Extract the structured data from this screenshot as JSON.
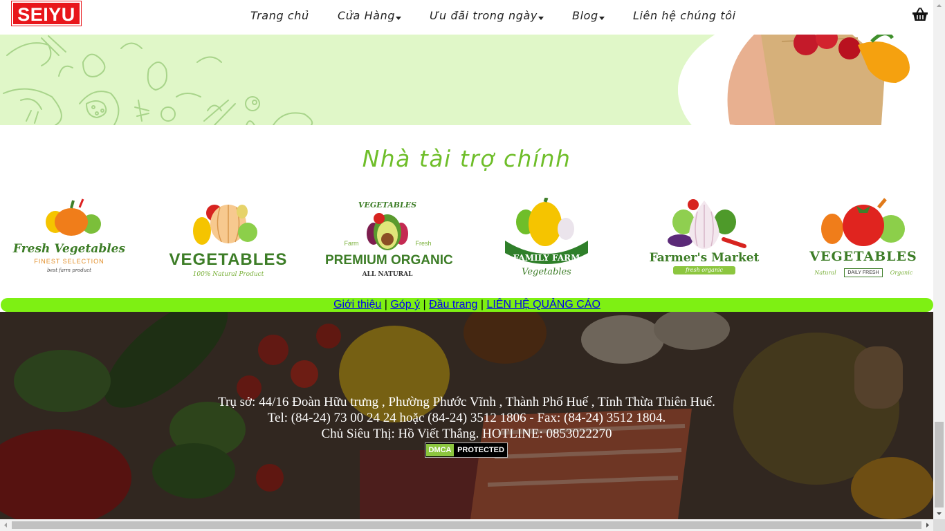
{
  "header": {
    "logo_text": "SEIYU",
    "nav": [
      {
        "label": "Trang chủ",
        "has_dropdown": false
      },
      {
        "label": "Cửa Hàng",
        "has_dropdown": true
      },
      {
        "label": "Ưu đãi trong ngày",
        "has_dropdown": true
      },
      {
        "label": "Blog",
        "has_dropdown": true
      },
      {
        "label": "Liên hệ chúng tôi",
        "has_dropdown": false
      }
    ],
    "cart_icon": "basket-icon"
  },
  "sponsors": {
    "title": "Nhà tài trợ chính",
    "items": [
      {
        "name": "Fresh Vegetables",
        "tagline": "FINEST SELECTION",
        "sub": "best farm product"
      },
      {
        "name": "VEGETABLES",
        "tagline": "100% Natural Product",
        "sub": ""
      },
      {
        "name": "PREMIUM ORGANIC",
        "tagline": "ALL NATURAL",
        "sub": "VEGETABLES",
        "left": "Farm",
        "right": "Fresh"
      },
      {
        "name": "FAMILY FARM",
        "tagline": "Vegetables",
        "sub": ""
      },
      {
        "name": "Farmer's Market",
        "tagline": "fresh organic",
        "sub": ""
      },
      {
        "name": "VEGETABLES",
        "tagline": "DAILY FRESH",
        "left": "Natural",
        "right": "Organic"
      }
    ]
  },
  "footer_links": {
    "items": [
      "Giới thiệu",
      "Góp ý",
      "Đầu trang",
      "LIÊN HỆ QUẢNG CÁO"
    ],
    "separator": "|"
  },
  "footer": {
    "address": "Trụ sở: 44/16 Đoàn Hữu trưng , Phường Phước Vĩnh , Thành Phố Huế , Tỉnh Thừa Thiên Huế.",
    "phone": "Tel: (84-24) 73 00 24 24 hoặc (84-24) 3512 1806 - Fax: (84-24) 3512 1804.",
    "owner": "Chủ Siêu Thị: Hồ Viết Thắng. HOTLINE: 0853022270",
    "dmca_left": "DMCA",
    "dmca_right": "PROTECTED"
  },
  "colors": {
    "brand_red": "#e8161b",
    "accent_green": "#6fbe2a",
    "linkbar_green": "#7ef013",
    "hero_bg": "#e0f7c8"
  }
}
